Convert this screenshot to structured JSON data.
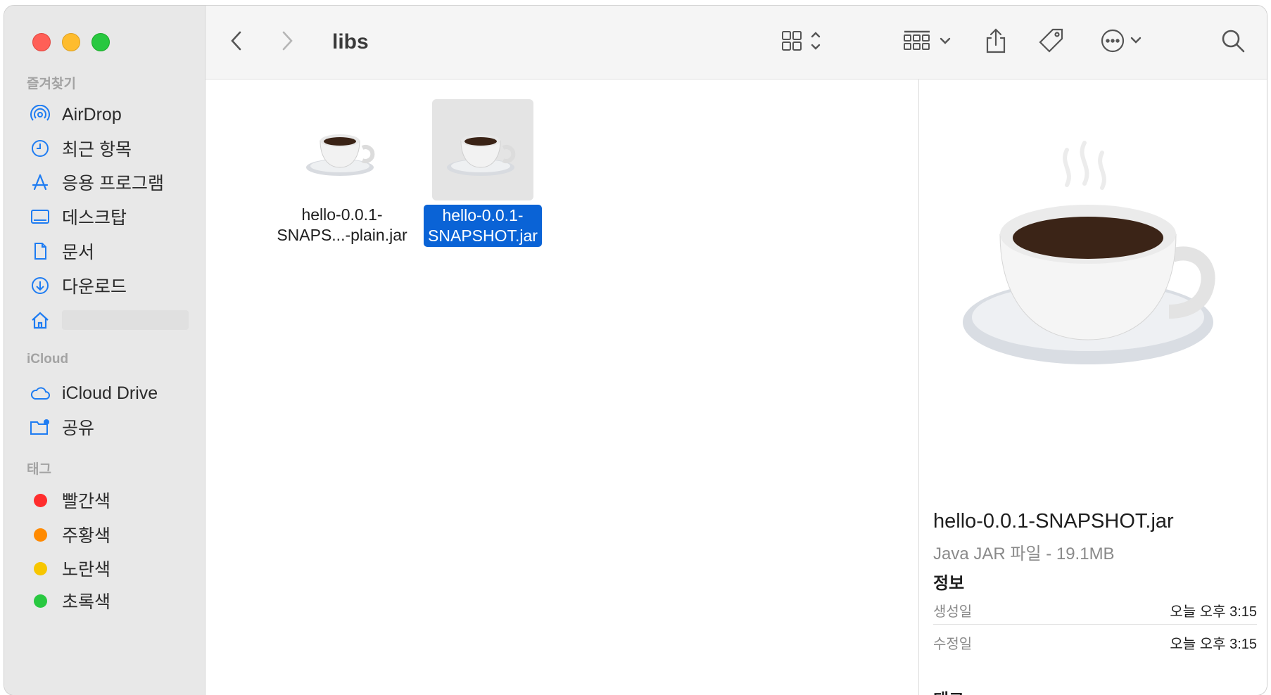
{
  "toolbar": {
    "title": "libs",
    "back_icon": "chevron-left-icon",
    "forward_icon": "chevron-right-icon",
    "view_icon": "grid-view-icon",
    "group_icon": "group-icon",
    "share_icon": "share-icon",
    "tag_icon": "tag-icon",
    "more_icon": "ellipsis-circle-icon",
    "search_icon": "search-icon"
  },
  "sidebar": {
    "favorites_title": "즐겨찾기",
    "favorites": [
      {
        "label": "AirDrop",
        "icon": "airdrop-icon"
      },
      {
        "label": "최근 항목",
        "icon": "clock-icon"
      },
      {
        "label": "응용 프로그램",
        "icon": "applications-icon"
      },
      {
        "label": "데스크탑",
        "icon": "desktop-icon"
      },
      {
        "label": "문서",
        "icon": "document-icon"
      },
      {
        "label": "다운로드",
        "icon": "download-icon"
      },
      {
        "label": "",
        "icon": "home-icon"
      }
    ],
    "icloud_title": "iCloud",
    "icloud": [
      {
        "label": "iCloud Drive",
        "icon": "cloud-icon"
      },
      {
        "label": "공유",
        "icon": "shared-folder-icon"
      }
    ],
    "tags_title": "태그",
    "tags": [
      {
        "label": "빨간색",
        "color": "#ff2d2d"
      },
      {
        "label": "주황색",
        "color": "#ff8a00"
      },
      {
        "label": "노란색",
        "color": "#f7c600"
      },
      {
        "label": "초록색",
        "color": "#28c840"
      }
    ]
  },
  "files": [
    {
      "name_line1": "hello-0.0.1-",
      "name_line2": "SNAPS...-plain.jar",
      "icon": "java-cup-icon",
      "selected": false
    },
    {
      "name_line1": "hello-0.0.1-",
      "name_line2": "SNAPSHOT.jar",
      "icon": "java-cup-icon",
      "selected": true
    }
  ],
  "preview": {
    "icon": "java-cup-icon",
    "name": "hello-0.0.1-SNAPSHOT.jar",
    "type": "Java JAR 파일 - 19.1MB",
    "info_title": "정보",
    "created_label": "생성일",
    "created_value": "오늘 오후 3:15",
    "modified_label": "수정일",
    "modified_value": "오늘 오후 3:15",
    "tags_title": "태그"
  },
  "colors": {
    "accent": "#0a63d6",
    "sidebar_icon": "#1e7cf2"
  }
}
